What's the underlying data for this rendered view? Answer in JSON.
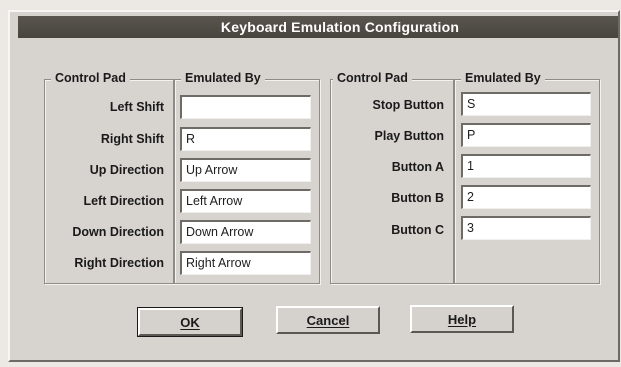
{
  "window": {
    "title": "Keyboard Emulation Configuration"
  },
  "left_group": {
    "header_control": "Control Pad",
    "header_emulated": "Emulated By",
    "rows": [
      {
        "label": "Left Shift",
        "value": ""
      },
      {
        "label": "Right Shift",
        "value": "R"
      },
      {
        "label": "Up Direction",
        "value": "Up Arrow"
      },
      {
        "label": "Left Direction",
        "value": "Left Arrow"
      },
      {
        "label": "Down Direction",
        "value": "Down Arrow"
      },
      {
        "label": "Right Direction",
        "value": "Right Arrow"
      }
    ]
  },
  "right_group": {
    "header_control": "Control Pad",
    "header_emulated": "Emulated By",
    "rows": [
      {
        "label": "Stop Button",
        "value": "S"
      },
      {
        "label": "Play Button",
        "value": "P"
      },
      {
        "label": "Button A",
        "value": "1"
      },
      {
        "label": "Button B",
        "value": "2"
      },
      {
        "label": "Button C",
        "value": "3"
      }
    ]
  },
  "buttons": {
    "ok": "OK",
    "cancel": "Cancel",
    "help": "Help"
  }
}
